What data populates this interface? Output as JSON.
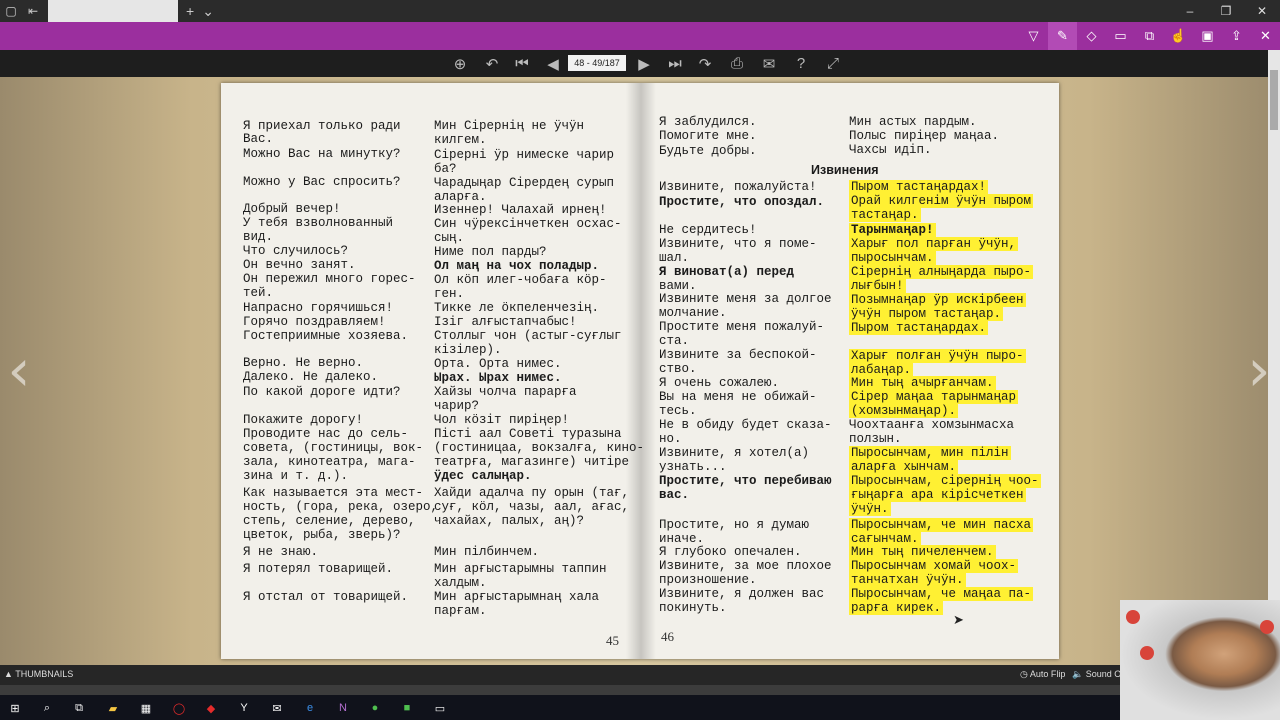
{
  "window": {
    "tab_title": "",
    "new_tab_icon": "plus-icon",
    "controls": [
      "minimize-icon",
      "restore-icon",
      "close-icon"
    ]
  },
  "reader": {
    "page_indicator": "48 - 49/187",
    "toolbar_icons": [
      "zoom-in-icon",
      "undo-icon",
      "first-page-icon",
      "prev-page-icon",
      "next-page-icon",
      "last-page-icon",
      "forward-icon",
      "print-icon",
      "email-icon",
      "help-icon",
      "fullscreen-icon"
    ],
    "thumbnails_label": "THUMBNAILS",
    "auto_flip_label": "Auto Flip",
    "sound_label": "Sound On"
  },
  "book": {
    "left_page_number": "45",
    "right_page_number": "46",
    "heading": "Извинения",
    "left_lines": [
      {
        "t": "Я приехал только ради"
      },
      {
        "t": "Вас."
      },
      {
        "t": "Можно Вас на минутку?"
      },
      {
        "t": "Можно у Вас спросить?"
      },
      {
        "t": "Добрый вечер!"
      },
      {
        "t": "У тебя взволнованный"
      },
      {
        "t": "вид."
      },
      {
        "t": "Что случилось?"
      },
      {
        "t": "Он вечно занят."
      },
      {
        "t": "Он пережил много горес-"
      },
      {
        "t": "тей."
      },
      {
        "t": "Напрасно горячишься!"
      },
      {
        "t": "Горячо поздравляем!"
      },
      {
        "t": "Гостеприимные хозяева."
      },
      {
        "t": "Верно. Не верно."
      },
      {
        "t": "Далеко. Не далеко."
      },
      {
        "t": "По какой дороге идти?"
      },
      {
        "t": "Покажите дорогу!"
      },
      {
        "t": "Проводите нас до сель-"
      },
      {
        "t": "совета, (гостиницы, вок-"
      },
      {
        "t": "зала, кинотеатра, мага-"
      },
      {
        "t": "зина и т. д.)."
      },
      {
        "t": "Как называется эта мест-"
      },
      {
        "t": "ность, (гора, река, озеро,"
      },
      {
        "t": "степь, селение, дерево,"
      },
      {
        "t": "цветок, рыба, зверь)?"
      },
      {
        "t": "Я не знаю."
      },
      {
        "t": "Я потерял товарищей."
      },
      {
        "t": "Я отстал от товарищей."
      }
    ],
    "left_hakas": [
      {
        "t": "Мин Сірернің не ӱчӱн"
      },
      {
        "t": "килгем."
      },
      {
        "t": "Сірерні ӱр нимеске чарир"
      },
      {
        "t": "ба?"
      },
      {
        "t": "Чарадыңар Сірердең сурып"
      },
      {
        "t": "аларға."
      },
      {
        "t": "Изеннер! Чалахай ирнең!"
      },
      {
        "t": "Син чӱрексінчеткен осхас-"
      },
      {
        "t": "сың."
      },
      {
        "t": "Ниме пол парды?"
      },
      {
        "t": "Ол маң на чох поладыр."
      },
      {
        "t": "Ол кӧп илег-чобаға кӧр-"
      },
      {
        "t": "ген."
      },
      {
        "t": "Тикке ле ӧкпеленчезің."
      },
      {
        "t": "Ізіг алғыстапчабыс!"
      },
      {
        "t": "Столлыг чон (астыг-суғлыг"
      },
      {
        "t": "кізілер)."
      },
      {
        "t": "Орта. Орта нимес."
      },
      {
        "t": "Ырах. Ырах нимес."
      },
      {
        "t": "Хайзы чолча парарға"
      },
      {
        "t": "чарир?"
      },
      {
        "t": "Чол кӧзіт пиріңер!"
      },
      {
        "t": "Пісті аал Советі туразына"
      },
      {
        "t": "(гостиницаа, вокзалға, кино-"
      },
      {
        "t": "театрға, магазинге) читіре"
      },
      {
        "t": "ӱдес салыңар."
      },
      {
        "t": "Хайди адалча пу орын (тағ,"
      },
      {
        "t": "суғ, кӧл, чазы, аал, ағас,"
      },
      {
        "t": "чахайах, палых, аң)?"
      },
      {
        "t": "Мин пілбинчем."
      },
      {
        "t": "Мин арғыстарымны таппин"
      },
      {
        "t": "халдым."
      },
      {
        "t": "Мин арғыстарымнаң хала"
      },
      {
        "t": "парғам."
      }
    ],
    "right_lines": [
      {
        "t": "Я заблудился."
      },
      {
        "t": "Помогите мне."
      },
      {
        "t": "Будьте добры."
      },
      {
        "t": "Извините, пожалуйста!"
      },
      {
        "t": "Простите, что опоздал."
      },
      {
        "t": "Не сердитесь!"
      },
      {
        "t": "Извините, что я поме-"
      },
      {
        "t": "шал."
      },
      {
        "t": "Я виноват(а) перед"
      },
      {
        "t": "вами."
      },
      {
        "t": "Извините меня за долгое"
      },
      {
        "t": "молчание."
      },
      {
        "t": "Простите меня пожалуй-"
      },
      {
        "t": "ста."
      },
      {
        "t": "Извините за беспокой-"
      },
      {
        "t": "ство."
      },
      {
        "t": "Я очень сожалею."
      },
      {
        "t": "Вы на меня не обижай-"
      },
      {
        "t": "тесь."
      },
      {
        "t": "Не в обиду будет сказа-"
      },
      {
        "t": "но."
      },
      {
        "t": "Извините, я хотел(а)"
      },
      {
        "t": "узнать..."
      },
      {
        "t": "Простите, что перебиваю"
      },
      {
        "t": "вас."
      },
      {
        "t": "Простите, но я думаю"
      },
      {
        "t": "иначе."
      },
      {
        "t": "Я глубоко опечален."
      },
      {
        "t": "Извините, за мое плохое"
      },
      {
        "t": "произношение."
      },
      {
        "t": "Извините, я должен вас"
      },
      {
        "t": "покинуть."
      }
    ],
    "right_hakas": [
      {
        "t": "Мин астых пардым."
      },
      {
        "t": "Полыс пиріңер маңаа."
      },
      {
        "t": "Чахсы идіп."
      },
      {
        "t": "Пыром тастаңардах!"
      },
      {
        "t": "Орай килгенім ӱчӱн пыром"
      },
      {
        "t": "тастаңар."
      },
      {
        "t": "Тарынмаңар!"
      },
      {
        "t": "Харығ пол парған ӱчӱн,"
      },
      {
        "t": "пыросынчам."
      },
      {
        "t": "Сірернің алныңарда пыро-"
      },
      {
        "t": "лығбын!"
      },
      {
        "t": "Позымнаңар ӱр искірбеен"
      },
      {
        "t": "ӱчӱн пыром тастаңар."
      },
      {
        "t": "Пыром тастаңардах."
      },
      {
        "t": "Харығ полған ӱчӱн пыро-"
      },
      {
        "t": "лабаңар."
      },
      {
        "t": "Мин тың ачырғанчам."
      },
      {
        "t": "Сірер маңаа тарынмаңар"
      },
      {
        "t": "(хомзынмаңар)."
      },
      {
        "t": "Чоохтаанға хомзынмасха"
      },
      {
        "t": "ползын."
      },
      {
        "t": "Пыросынчам, мин пілін"
      },
      {
        "t": "аларға хынчам."
      },
      {
        "t": "Пыросынчам, сірернің чоо-"
      },
      {
        "t": "ғыңарға ара кірісчеткен"
      },
      {
        "t": "ӱчӱн."
      },
      {
        "t": "Пыросынчам, че мин пасха"
      },
      {
        "t": "сағынчам."
      },
      {
        "t": "Мин тың пичеленчем."
      },
      {
        "t": "Пыросынчам хомай чоох-"
      },
      {
        "t": "танчатхан ӱчӱн."
      },
      {
        "t": "Пыросынчам, че маңаа па-"
      },
      {
        "t": "рарға кирек."
      }
    ]
  },
  "taskbar": {
    "icons": [
      "windows-start-icon",
      "search-icon",
      "task-view-icon",
      "file-explorer-icon",
      "store-icon",
      "opera-icon",
      "app-icon",
      "yandex-icon",
      "mail-icon",
      "edge-icon",
      "onenote-icon",
      "app2-icon",
      "app3-icon",
      "app4-icon"
    ]
  },
  "colors": {
    "accent": "#9b2f9e",
    "highlight": "#fff033",
    "page": "#f2f0ea"
  }
}
